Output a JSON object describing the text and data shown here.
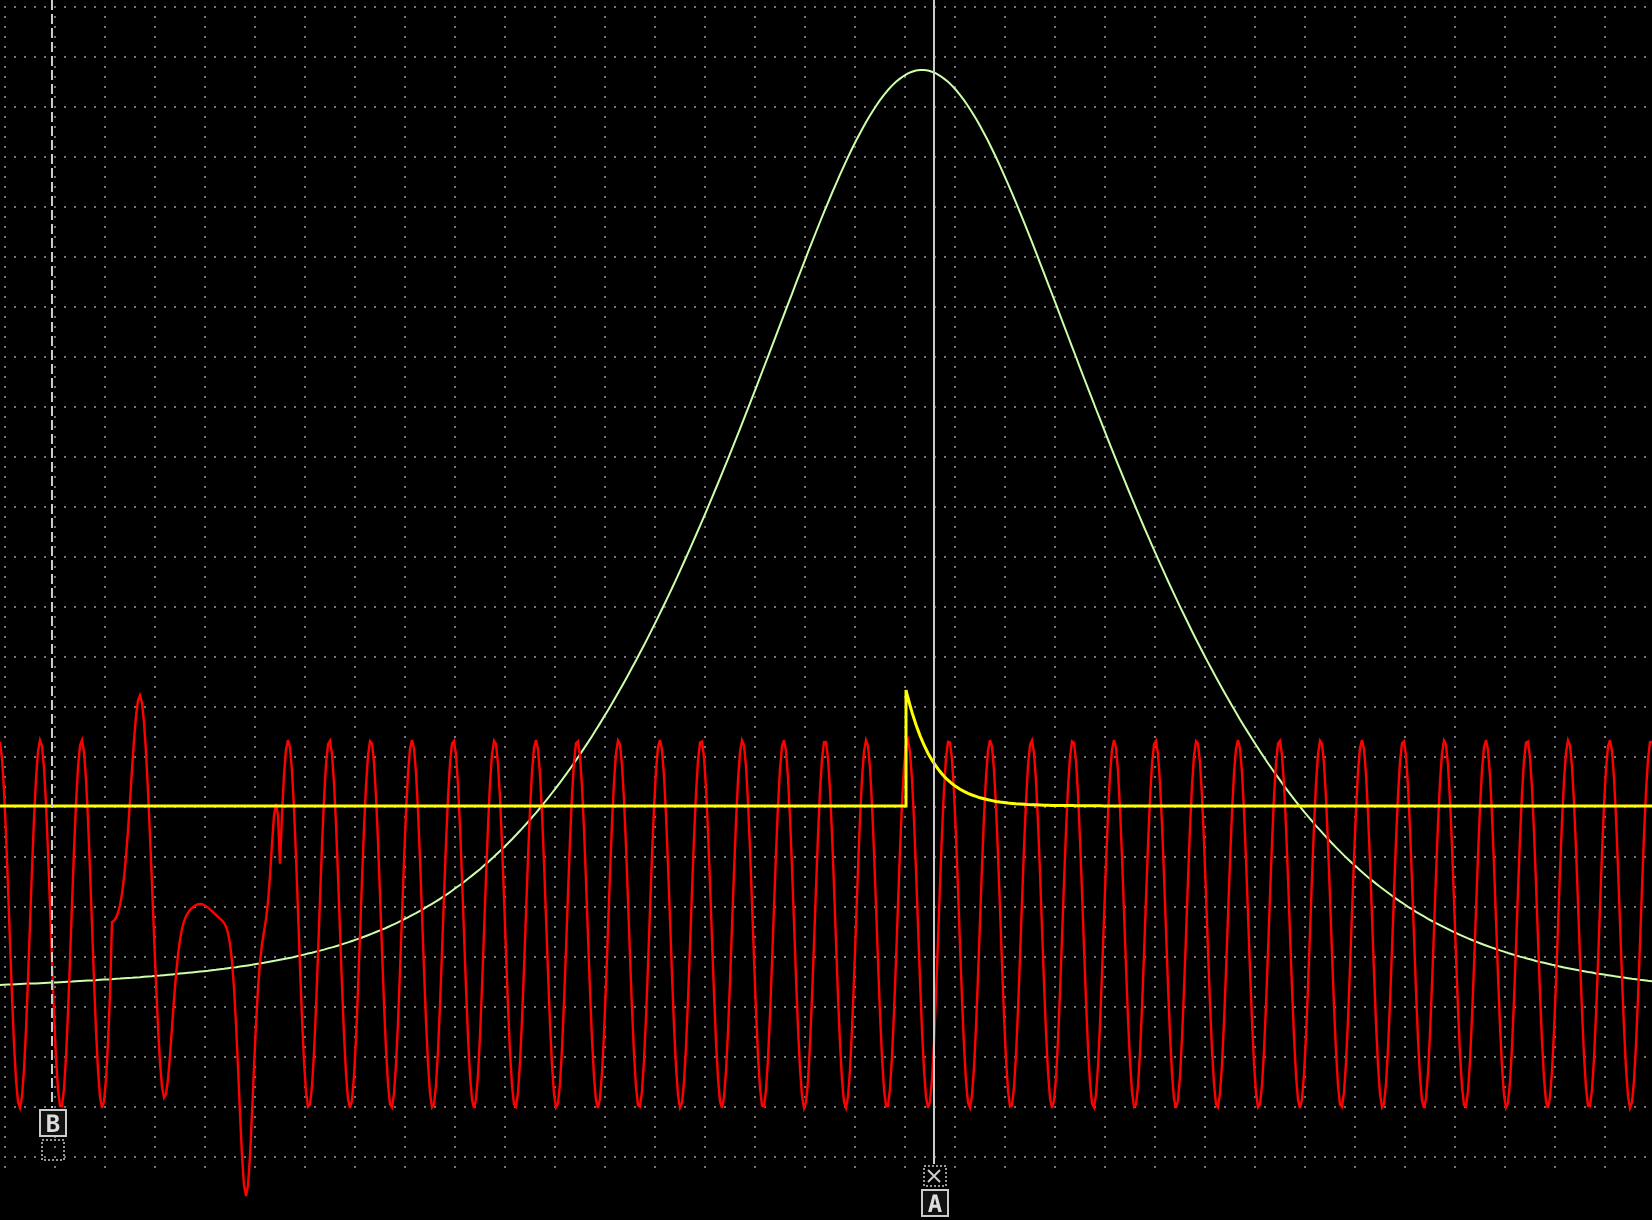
{
  "cursors": [
    {
      "label": "B"
    },
    {
      "label": "A"
    }
  ]
}
